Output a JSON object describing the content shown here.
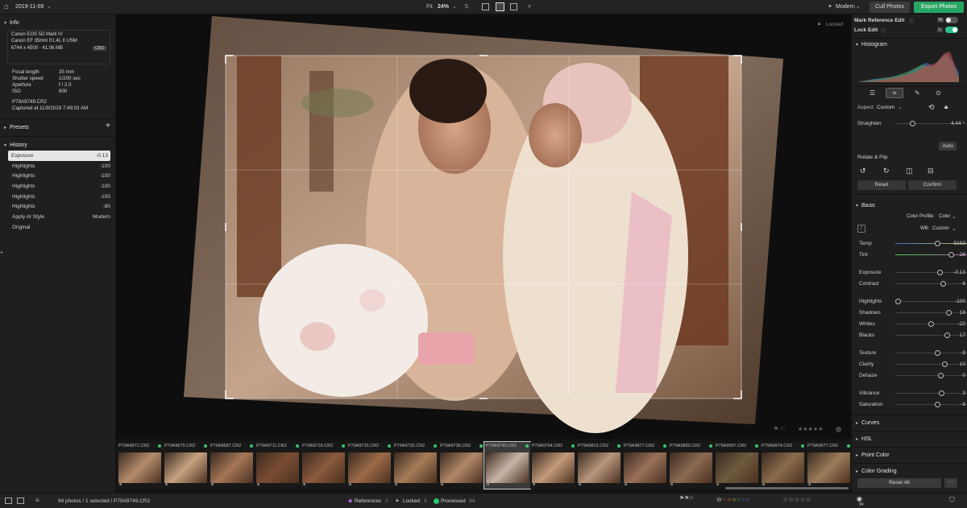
{
  "topbar": {
    "date": "2019-11-09",
    "fit": "Fit",
    "zoom": "24%",
    "style": "Modern",
    "cull": "Cull Photos",
    "export": "Export Photos"
  },
  "info": {
    "title": "Info",
    "camera": "Canon EOS 5D Mark IV",
    "lens": "Canon EF 35mm f/1.4L II USM",
    "dims": "6744 x 4500 · 41.06 MB",
    "badge": "CR2",
    "focal_l": "Focal length",
    "focal_v": "35 mm",
    "shutter_l": "Shutter speed",
    "shutter_v": "1/200 sec",
    "aperture_l": "Aperture",
    "aperture_v": "f / 2.0",
    "iso_l": "ISO",
    "iso_v": "800",
    "file": "P79A9749.CR2",
    "captured": "Captured at 11/9/2019 7:49:03 AM"
  },
  "presets": {
    "title": "Presets"
  },
  "history": {
    "title": "History",
    "items": [
      {
        "name": "Exposure",
        "val": "-0.13"
      },
      {
        "name": "Highlights",
        "val": "-100"
      },
      {
        "name": "Highlights",
        "val": "-100"
      },
      {
        "name": "Highlights",
        "val": "-100"
      },
      {
        "name": "Highlights",
        "val": "-100"
      },
      {
        "name": "Highlights",
        "val": "-80"
      },
      {
        "name": "Apply AI Style",
        "val": "Modern"
      },
      {
        "name": "Original",
        "val": ""
      }
    ]
  },
  "center": {
    "locked": "Locked"
  },
  "right": {
    "mark_ref": "Mark Reference Edit",
    "mark_key": "M",
    "lock_edit": "Lock Edit",
    "lock_key": "L",
    "histogram": "Histogram",
    "aspect_l": "Aspect",
    "aspect_v": "Custom",
    "straighten_l": "Straighten",
    "straighten_v": "4.44 °",
    "auto": "Auto",
    "rotate": "Rotate & Flip",
    "reset": "Reset",
    "confirm": "Confirm",
    "basic": "Basic",
    "profile_l": "Color Profile:",
    "profile_v": "Color",
    "wb_l": "WB:",
    "wb_v": "Custom",
    "sliders": [
      {
        "l": "Temp",
        "v": "5183",
        "p": 0.46
      },
      {
        "l": "Tint",
        "v": "28",
        "p": 0.62
      },
      {
        "l": "Exposure",
        "v": "-0.13",
        "p": 0.49
      },
      {
        "l": "Contrast",
        "v": "6",
        "p": 0.53
      },
      {
        "l": "Highlights",
        "v": "-100",
        "p": 0.0
      },
      {
        "l": "Shadows",
        "v": "18",
        "p": 0.59
      },
      {
        "l": "Whites",
        "v": "-22",
        "p": 0.39
      },
      {
        "l": "Blacks",
        "v": "17",
        "p": 0.58
      },
      {
        "l": "Texture",
        "v": "-9",
        "p": 0.46
      },
      {
        "l": "Clarity",
        "v": "10",
        "p": 0.55
      },
      {
        "l": "Dehaze",
        "v": "0",
        "p": 0.5
      },
      {
        "l": "Vibrance",
        "v": "3",
        "p": 0.51
      },
      {
        "l": "Saturation",
        "v": "-9",
        "p": 0.46
      }
    ],
    "curves": "Curves",
    "hsl": "HSL",
    "point": "Point Color",
    "grading": "Color Grading",
    "reset_all": "Reset All"
  },
  "film": [
    {
      "n": "P79A9671.CR2"
    },
    {
      "n": "P79A9679.CR2"
    },
    {
      "n": "P79A9687.CR2"
    },
    {
      "n": "P79A9711.CR2"
    },
    {
      "n": "P79A9718.CR2"
    },
    {
      "n": "P79A9726.CR2"
    },
    {
      "n": "P79A9732.CR2"
    },
    {
      "n": "P79A9738.CR2"
    },
    {
      "n": "P79A9749.CR2"
    },
    {
      "n": "P79A9764.CR2"
    },
    {
      "n": "P79A9812.CR2"
    },
    {
      "n": "P79A9877.CR2"
    },
    {
      "n": "P79A9883.CR2"
    },
    {
      "n": "P79A9967.CR2"
    },
    {
      "n": "P79A9974.CR2"
    },
    {
      "n": "P79A9977.CR2"
    }
  ],
  "bottom": {
    "status": "94 photos / 1 selected / P79A9749.CR2",
    "refs": "References",
    "refs_n": "2",
    "locked": "Locked",
    "locked_n": "3",
    "processed": "Processed",
    "processed_n": "94",
    "count1": "94",
    "count2": "0",
    "count3": "94",
    "count4": "94"
  }
}
